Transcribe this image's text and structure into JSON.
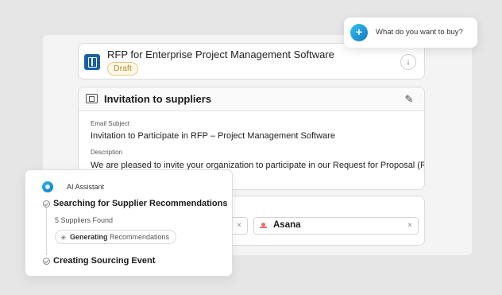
{
  "rfp": {
    "title": "RFP for Enterprise Project Management Software",
    "status": "Draft",
    "download_glyph": "↓"
  },
  "invitation": {
    "title": "Invitation to suppliers",
    "email_subject_label": "Email Subject",
    "email_subject": "Invitation to Participate in RFP – Project Management Software",
    "description_label": "Description",
    "description": "We are pleased to invite your organization to participate in our Request for Proposal (RFP)"
  },
  "suppliers": {
    "items": [
      {
        "name": "",
        "remove": "×"
      },
      {
        "name": "Asana",
        "remove": "×"
      }
    ]
  },
  "assistant": {
    "label": "AI Assistant",
    "step1_title": "Searching for Supplier Recommendations",
    "found": "5 Suppliers Found",
    "generating_bold": "Generating",
    "generating_rest": " Recommendations",
    "step2_title": "Creating Sourcing Event",
    "chevron": "⌄"
  },
  "buy_prompt": {
    "text": "What do you want to buy?",
    "icon_glyph": "+"
  },
  "icons": {
    "rfp": "document-icon",
    "invitation": "megaphone-icon",
    "edit": "pencil-icon",
    "download": "arrow-down-icon",
    "assistant": "ai-assistant-icon",
    "step": "check-circle-icon",
    "sparkle": "sparkle-icon",
    "buy": "plus-sparkle-icon"
  },
  "colors": {
    "brand_blue": "#1a5fa8",
    "draft_badge": "#b98a1c",
    "ai_gradient_start": "#2bb3e8",
    "ai_gradient_end": "#0e7fc2",
    "asana_logo": "#f06a6a"
  }
}
